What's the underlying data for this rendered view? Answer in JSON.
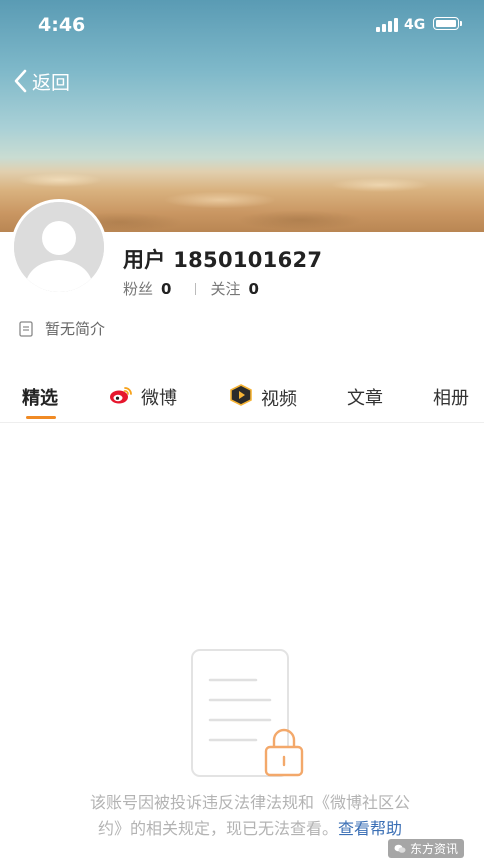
{
  "status_bar": {
    "time": "4:46",
    "network": "4G"
  },
  "nav": {
    "back_label": "返回"
  },
  "profile": {
    "username": "用户 1850101627",
    "fans_label": "粉丝",
    "fans_count": "0",
    "following_label": "关注",
    "following_count": "0",
    "bio": "暂无简介"
  },
  "tabs": [
    {
      "label": "精选",
      "icon": "none"
    },
    {
      "label": "微博",
      "icon": "weibo-icon"
    },
    {
      "label": "视频",
      "icon": "video-icon"
    },
    {
      "label": "文章",
      "icon": "none"
    },
    {
      "label": "相册",
      "icon": "none"
    }
  ],
  "empty_state": {
    "line1": "该账号因被投诉违反法律法规和《微博社区公",
    "line2": "约》的相关规定，现已无法查看。",
    "help_link": "查看帮助"
  },
  "watermark": "东方资讯",
  "colors": {
    "accent": "#f08a24",
    "link": "#3b6fb5"
  }
}
